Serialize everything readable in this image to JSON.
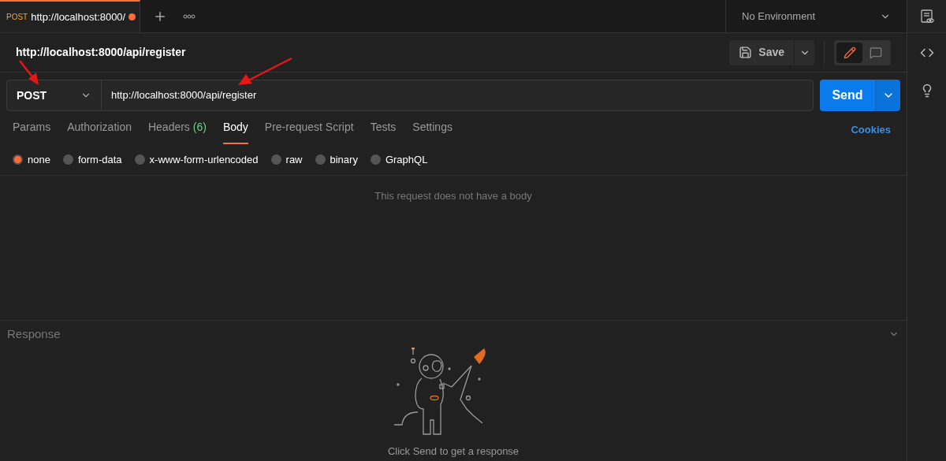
{
  "tab_bar": {
    "tabs": [
      {
        "method": "POST",
        "title": "http://localhost:8000/",
        "selected": true,
        "unsaved": true
      }
    ]
  },
  "environment": {
    "value": "No Environment"
  },
  "request": {
    "name": "http://localhost:8000/api/register",
    "save_label": "Save",
    "modes": [
      {
        "kind": "edit",
        "selected": true
      },
      {
        "kind": "comment",
        "selected": false
      }
    ]
  },
  "url_bar": {
    "method": "POST",
    "url": "http://localhost:8000/api/register",
    "send_label": "Send"
  },
  "request_tabs": [
    {
      "label": "Params",
      "selected": false
    },
    {
      "label": "Authorization",
      "selected": false
    },
    {
      "label": "Headers",
      "count": "(6)",
      "selected": false
    },
    {
      "label": "Body",
      "selected": true
    },
    {
      "label": "Pre-request Script",
      "selected": false
    },
    {
      "label": "Tests",
      "selected": false
    },
    {
      "label": "Settings",
      "selected": false
    }
  ],
  "cookies_link": "Cookies",
  "body_types": [
    {
      "label": "none",
      "selected": true
    },
    {
      "label": "form-data",
      "selected": false
    },
    {
      "label": "x-www-form-urlencoded",
      "selected": false
    },
    {
      "label": "raw",
      "selected": false
    },
    {
      "label": "binary",
      "selected": false
    },
    {
      "label": "GraphQL",
      "selected": false
    }
  ],
  "body_message": "This request does not have a body",
  "response": {
    "title": "Response",
    "hint": "Click Send to get a response"
  }
}
